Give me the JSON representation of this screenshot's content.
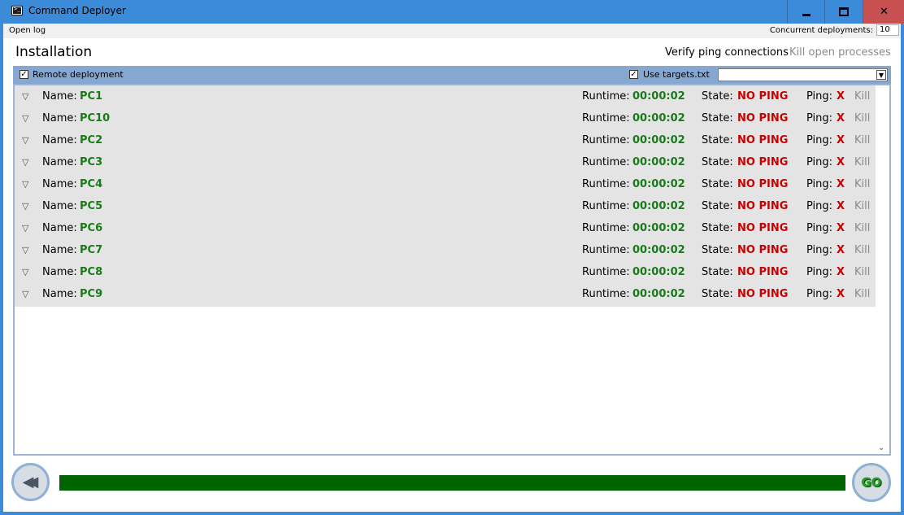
{
  "window": {
    "title": "Command Deployer"
  },
  "menu": {
    "open_log": "Open log",
    "concurrent_label": "Concurrent deployments:",
    "concurrent_value": "10"
  },
  "header": {
    "title": "Installation",
    "verify_ping": "Verify ping connections",
    "kill_open_processes": "Kill open processes"
  },
  "options": {
    "remote_deployment": {
      "label": "Remote deployment",
      "checked": true
    },
    "use_targets": {
      "label": "Use targets.txt",
      "checked": true
    },
    "targets_dropdown_value": ""
  },
  "row_labels": {
    "name": "Name:",
    "runtime": "Runtime:",
    "state": "State:",
    "ping": "Ping:",
    "kill": "Kill"
  },
  "deployments": [
    {
      "name": "PC1",
      "runtime": "00:00:02",
      "state": "NO PING",
      "ping": "X"
    },
    {
      "name": "PC10",
      "runtime": "00:00:02",
      "state": "NO PING",
      "ping": "X"
    },
    {
      "name": "PC2",
      "runtime": "00:00:02",
      "state": "NO PING",
      "ping": "X"
    },
    {
      "name": "PC3",
      "runtime": "00:00:02",
      "state": "NO PING",
      "ping": "X"
    },
    {
      "name": "PC4",
      "runtime": "00:00:02",
      "state": "NO PING",
      "ping": "X"
    },
    {
      "name": "PC5",
      "runtime": "00:00:02",
      "state": "NO PING",
      "ping": "X"
    },
    {
      "name": "PC6",
      "runtime": "00:00:02",
      "state": "NO PING",
      "ping": "X"
    },
    {
      "name": "PC7",
      "runtime": "00:00:02",
      "state": "NO PING",
      "ping": "X"
    },
    {
      "name": "PC8",
      "runtime": "00:00:02",
      "state": "NO PING",
      "ping": "X"
    },
    {
      "name": "PC9",
      "runtime": "00:00:02",
      "state": "NO PING",
      "ping": "X"
    }
  ],
  "progress": {
    "fraction": 1.0
  },
  "buttons": {
    "go": "GO"
  },
  "colors": {
    "titlebar": "#3c8bd9",
    "option_bar": "#86a7cf",
    "ok_green": "#1a7a1a",
    "error_red": "#c80000",
    "progress_fill": "#006400"
  },
  "icons": {
    "app": "terminal-icon",
    "expand": "triangle-down-icon",
    "back": "rewind-icon"
  }
}
